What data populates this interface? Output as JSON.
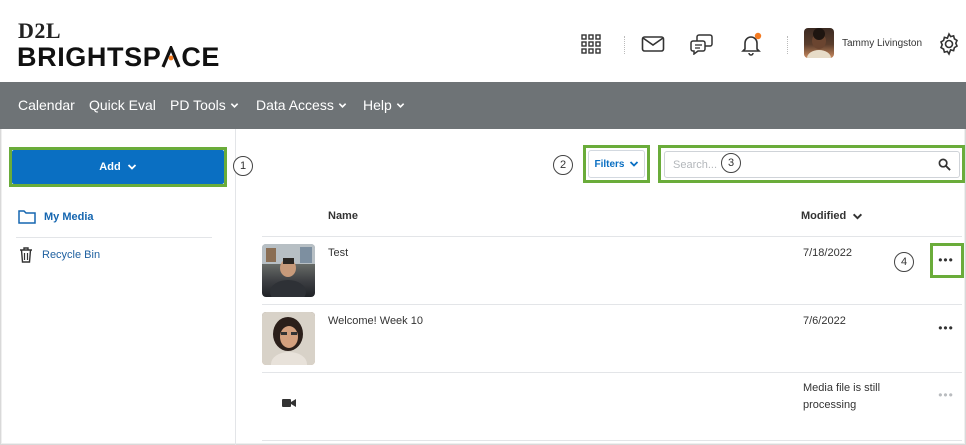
{
  "header": {
    "logo_top": "D2L",
    "logo_bottom_part1": "BRIGHTSP",
    "logo_bottom_part2": "CE",
    "user_name": "Tammy Livingston",
    "accent_color": "#f47a20"
  },
  "navbar": {
    "items": [
      {
        "label": "Calendar"
      },
      {
        "label": "Quick Eval"
      },
      {
        "label": "PD Tools"
      },
      {
        "label": "Data Access"
      },
      {
        "label": "Help"
      }
    ]
  },
  "sidebar": {
    "add_label": "Add",
    "items": [
      {
        "label": "My Media",
        "icon": "folder-icon"
      },
      {
        "label": "Recycle Bin",
        "icon": "trash-icon"
      }
    ]
  },
  "toolbar": {
    "filters_label": "Filters",
    "search_placeholder": "Search..."
  },
  "callouts": [
    "1",
    "2",
    "3",
    "4"
  ],
  "table": {
    "col_name": "Name",
    "col_modified": "Modified",
    "rows": [
      {
        "title": "Test",
        "modified": "7/18/2022"
      },
      {
        "title": "Welcome! Week 10",
        "modified": "7/6/2022"
      },
      {
        "title": "",
        "modified": "",
        "status": "Media file is still processing"
      }
    ]
  },
  "colors": {
    "primary": "#0a6fc2",
    "navbar": "#6e7376",
    "highlight": "#6aac3a"
  }
}
